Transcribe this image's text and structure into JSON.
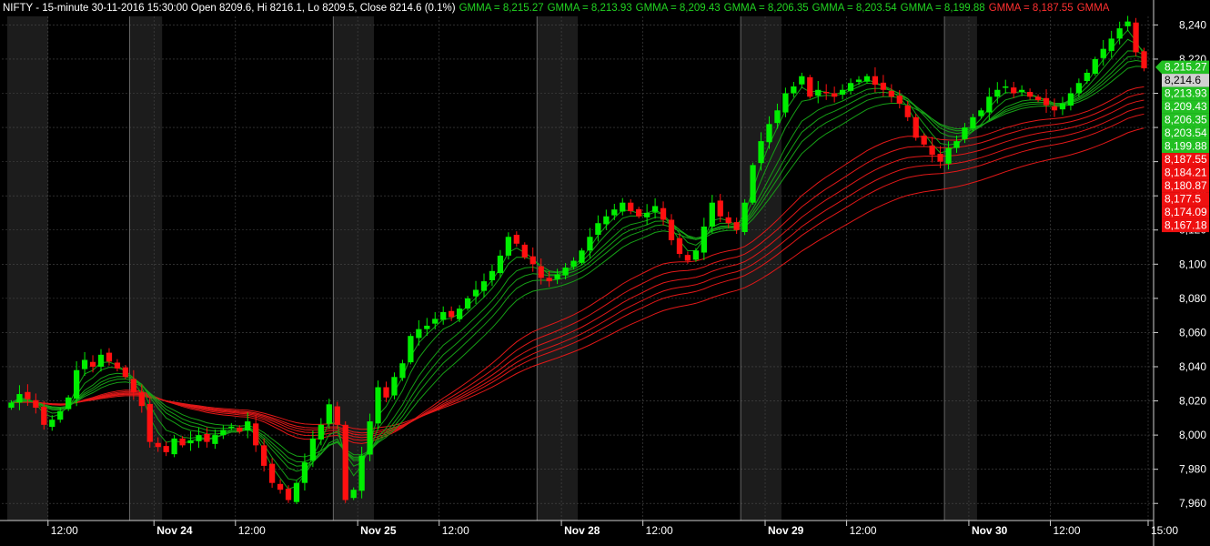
{
  "header": {
    "title": "NIFTY - 15-minute 30-11-2016 15:30:00 Open 8209.6, Hi 8216.1, Lo 8209.5, Close 8214.6 (0.1%)",
    "gmma_values": [
      {
        "label": "GMMA = 8,215.27",
        "color": "#22d322"
      },
      {
        "label": "GMMA = 8,213.93",
        "color": "#22d322"
      },
      {
        "label": "GMMA = 8,209.43",
        "color": "#22d322"
      },
      {
        "label": "GMMA = 8,206.35",
        "color": "#22d322"
      },
      {
        "label": "GMMA = 8,203.54",
        "color": "#22d322"
      },
      {
        "label": "GMMA = 8,199.88",
        "color": "#22d322"
      },
      {
        "label": "GMMA = 8,187.55",
        "color": "#ff3030"
      },
      {
        "label": "GMMA",
        "color": "#ff3030"
      }
    ]
  },
  "chart_data": {
    "type": "candlestick",
    "symbol": "NIFTY",
    "interval": "15-minute",
    "ylim": [
      7950,
      8245
    ],
    "y_ticks": [
      7960,
      7980,
      8000,
      8020,
      8040,
      8060,
      8080,
      8100,
      8120,
      8140,
      8160,
      8180,
      8200,
      8220,
      8240
    ],
    "y_tick_labels": [
      "7,960",
      "7,980",
      "8,000",
      "8,020",
      "8,040",
      "8,060",
      "8,080",
      "8,100",
      "8,120",
      "8,140",
      "8,160",
      "8,180",
      "8,200",
      "8,220",
      "8,240"
    ],
    "x_labels": [
      {
        "label": "12:00",
        "bar": 5,
        "bold": false
      },
      {
        "label": "Nov 24",
        "bar": 18,
        "bold": true
      },
      {
        "label": "12:00",
        "bar": 28,
        "bold": false
      },
      {
        "label": "Nov 25",
        "bar": 43,
        "bold": true
      },
      {
        "label": "12:00",
        "bar": 53,
        "bold": false
      },
      {
        "label": "Nov 28",
        "bar": 68,
        "bold": true
      },
      {
        "label": "12:00",
        "bar": 78,
        "bold": false
      },
      {
        "label": "Nov 29",
        "bar": 93,
        "bold": true
      },
      {
        "label": "12:00",
        "bar": 103,
        "bold": false
      },
      {
        "label": "Nov 30",
        "bar": 118,
        "bold": true
      },
      {
        "label": "12:00",
        "bar": 128,
        "bold": false
      },
      {
        "label": "15:00",
        "bar": 140,
        "bold": false
      }
    ],
    "day_boundaries": [
      15,
      40,
      65,
      90,
      115
    ],
    "session_shades": [
      [
        0,
        4
      ],
      [
        15,
        18
      ],
      [
        40,
        44
      ],
      [
        65,
        69
      ],
      [
        90,
        94
      ],
      [
        115,
        118
      ]
    ],
    "closes": [
      8019,
      8024,
      8021,
      8016,
      8006,
      8009,
      8014,
      8022,
      8038,
      8044,
      8040,
      8047,
      8043,
      8039,
      8034,
      8025,
      8017,
      7996,
      7993,
      7990,
      7998,
      7994,
      7997,
      8000,
      7996,
      8000,
      8003,
      8005,
      8002,
      8008,
      7994,
      7982,
      7972,
      7968,
      7962,
      7972,
      7984,
      7998,
      8006,
      8018,
      8006,
      7962,
      7968,
      7988,
      8008,
      8028,
      8022,
      8034,
      8042,
      8058,
      8062,
      8064,
      8068,
      8072,
      8069,
      8074,
      8080,
      8085,
      8090,
      8096,
      8105,
      8116,
      8112,
      8104,
      8100,
      8092,
      8090,
      8094,
      8098,
      8102,
      8108,
      8116,
      8124,
      8128,
      8132,
      8136,
      8131,
      8128,
      8130,
      8134,
      8126,
      8114,
      8106,
      8102,
      8108,
      8122,
      8136,
      8128,
      8124,
      8120,
      8136,
      8158,
      8172,
      8182,
      8190,
      8200,
      8204,
      8210,
      8198,
      8202,
      8200,
      8198,
      8202,
      8206,
      8208,
      8210,
      8205,
      8202,
      8198,
      8194,
      8186,
      8174,
      8170,
      8164,
      8160,
      8168,
      8172,
      8180,
      8186,
      8190,
      8198,
      8202,
      8204,
      8200,
      8202,
      8198,
      8196,
      8193,
      8190,
      8194,
      8200,
      8206,
      8212,
      8220,
      8226,
      8232,
      8238,
      8242,
      8224,
      8214.6
    ],
    "gmma_periods": {
      "short": [
        3,
        5,
        8,
        10,
        12,
        15
      ],
      "long": [
        30,
        35,
        40,
        45,
        50,
        60
      ]
    },
    "colors": {
      "bull": "#00ee00",
      "bear": "#ff1010",
      "short_ma": "#16a016",
      "long_ma": "#e01818",
      "grid": "#4a4a4a",
      "background": "#000000",
      "shade": "#1c1c1c"
    },
    "right_labels": [
      {
        "text": "8,215.27",
        "value": 8215.27,
        "bg": "#22c022",
        "fg": "#ffffff",
        "pointer": true
      },
      {
        "text": "8,214.6",
        "value": 8214.6,
        "bg": "#d0d0d0",
        "fg": "#000000",
        "pointer": false
      },
      {
        "text": "8,213.93",
        "value": 8213.93,
        "bg": "#22c022",
        "fg": "#ffffff",
        "pointer": false
      },
      {
        "text": "8,209.43",
        "value": 8209.43,
        "bg": "#22c022",
        "fg": "#ffffff",
        "pointer": false
      },
      {
        "text": "8,206.35",
        "value": 8206.35,
        "bg": "#22c022",
        "fg": "#ffffff",
        "pointer": false
      },
      {
        "text": "8,203.54",
        "value": 8203.54,
        "bg": "#22c022",
        "fg": "#ffffff",
        "pointer": false
      },
      {
        "text": "8,199.88",
        "value": 8199.88,
        "bg": "#22c022",
        "fg": "#ffffff",
        "pointer": false
      },
      {
        "text": "8,187.55",
        "value": 8187.55,
        "bg": "#ee1010",
        "fg": "#ffffff",
        "pointer": false
      },
      {
        "text": "8,184.21",
        "value": 8184.21,
        "bg": "#ee1010",
        "fg": "#ffffff",
        "pointer": false
      },
      {
        "text": "8,180.87",
        "value": 8180.87,
        "bg": "#ee1010",
        "fg": "#ffffff",
        "pointer": false
      },
      {
        "text": "8,177.5",
        "value": 8177.5,
        "bg": "#ee1010",
        "fg": "#ffffff",
        "pointer": false
      },
      {
        "text": "8,174.09",
        "value": 8174.09,
        "bg": "#ee1010",
        "fg": "#ffffff",
        "pointer": false
      },
      {
        "text": "8,167.18",
        "value": 8167.18,
        "bg": "#ee1010",
        "fg": "#ffffff",
        "pointer": false
      }
    ]
  }
}
